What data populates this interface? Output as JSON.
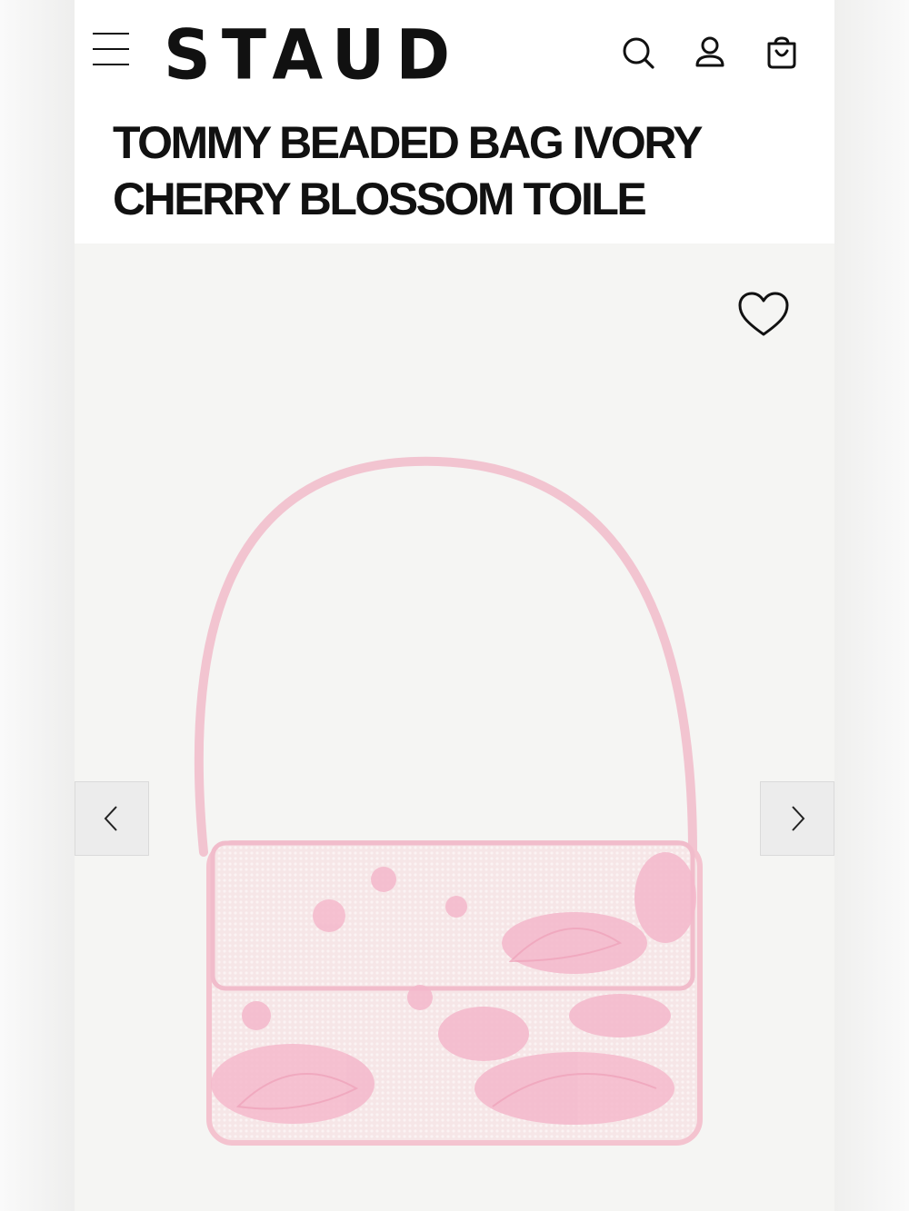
{
  "header": {
    "brand": "STAUD",
    "icons": [
      "menu-icon",
      "search-icon",
      "account-icon",
      "cart-icon"
    ]
  },
  "product": {
    "title_line1": "TOMMY BEADED BAG IVORY",
    "title_line2": "CHERRY BLOSSOM TOILE",
    "image_alt": "Tommy beaded bag ivory cherry blossom toile"
  },
  "gallery": {
    "icons": [
      "heart-icon",
      "chevron-left-icon",
      "chevron-right-icon"
    ]
  },
  "colors": {
    "accent": "#111111",
    "bag_pink": "#f4c6d2",
    "bag_ivory": "#f7e8e9",
    "background": "#f5f5f3"
  }
}
